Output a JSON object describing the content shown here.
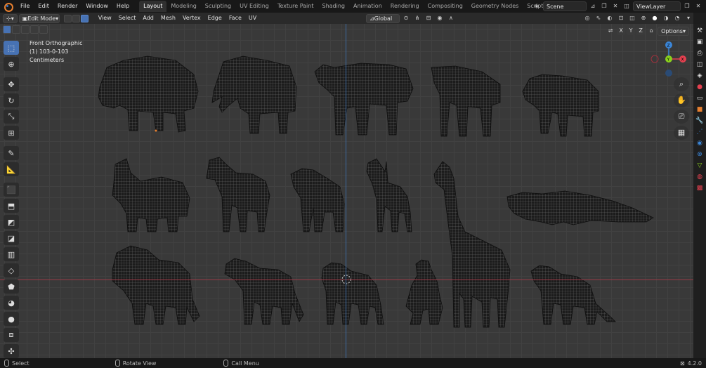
{
  "menus": [
    "File",
    "Edit",
    "Render",
    "Window",
    "Help"
  ],
  "workspaces": [
    {
      "label": "Layout",
      "active": true
    },
    {
      "label": "Modeling"
    },
    {
      "label": "Sculpting"
    },
    {
      "label": "UV Editing"
    },
    {
      "label": "Texture Paint"
    },
    {
      "label": "Shading"
    },
    {
      "label": "Animation"
    },
    {
      "label": "Rendering"
    },
    {
      "label": "Compositing"
    },
    {
      "label": "Geometry Nodes"
    },
    {
      "label": "Scripting"
    }
  ],
  "add_workspace": "+",
  "scene_name": "Scene",
  "view_layer": "ViewLayer",
  "header": {
    "mode": "Edit Mode",
    "menus": [
      "View",
      "Select",
      "Add",
      "Mesh",
      "Vertex",
      "Edge",
      "Face",
      "UV"
    ],
    "transform_orientation": "Global",
    "options_label": "Options",
    "axes": [
      "X",
      "Y",
      "Z"
    ]
  },
  "viewport": {
    "view_name": "Front Orthographic",
    "object_info": "(1) 103-0-103",
    "units": "Centimeters"
  },
  "gizmo": {
    "x_label": "X",
    "y_label": "Y",
    "z_label": "Z",
    "x_color": "#e3404f",
    "y_color": "#8ad11d",
    "z_color": "#3b86d8"
  },
  "status_bar": {
    "select": "Select",
    "rotate": "Rotate View",
    "menu": "Call Menu",
    "version": "4.2.0"
  },
  "colors": {
    "accent": "#4772b3",
    "mesh": "#1c1c1c",
    "wire": "#7a7a7a"
  }
}
